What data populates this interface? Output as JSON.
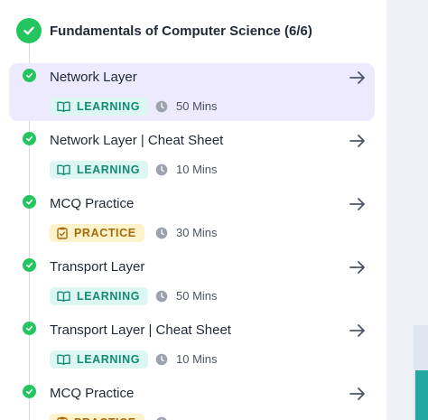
{
  "module": {
    "title": "Fundamentals of Computer Science (6/6)"
  },
  "colors": {
    "complete": "#22c55e",
    "active_bg": "#eceafc",
    "learning": "#138a73",
    "practice": "#a46a0b"
  },
  "items": [
    {
      "name": "Network Layer",
      "type": "LEARNING",
      "type_icon": "book-icon",
      "duration": "50 Mins",
      "active": true
    },
    {
      "name": "Network Layer | Cheat Sheet",
      "type": "LEARNING",
      "type_icon": "book-icon",
      "duration": "10 Mins",
      "active": false
    },
    {
      "name": "MCQ Practice",
      "type": "PRACTICE",
      "type_icon": "clipboard-icon",
      "duration": "30 Mins",
      "active": false
    },
    {
      "name": "Transport Layer",
      "type": "LEARNING",
      "type_icon": "book-icon",
      "duration": "50 Mins",
      "active": false
    },
    {
      "name": "Transport Layer | Cheat Sheet",
      "type": "LEARNING",
      "type_icon": "book-icon",
      "duration": "10 Mins",
      "active": false
    },
    {
      "name": "MCQ Practice",
      "type": "PRACTICE",
      "type_icon": "clipboard-icon",
      "duration": "",
      "active": false
    }
  ]
}
